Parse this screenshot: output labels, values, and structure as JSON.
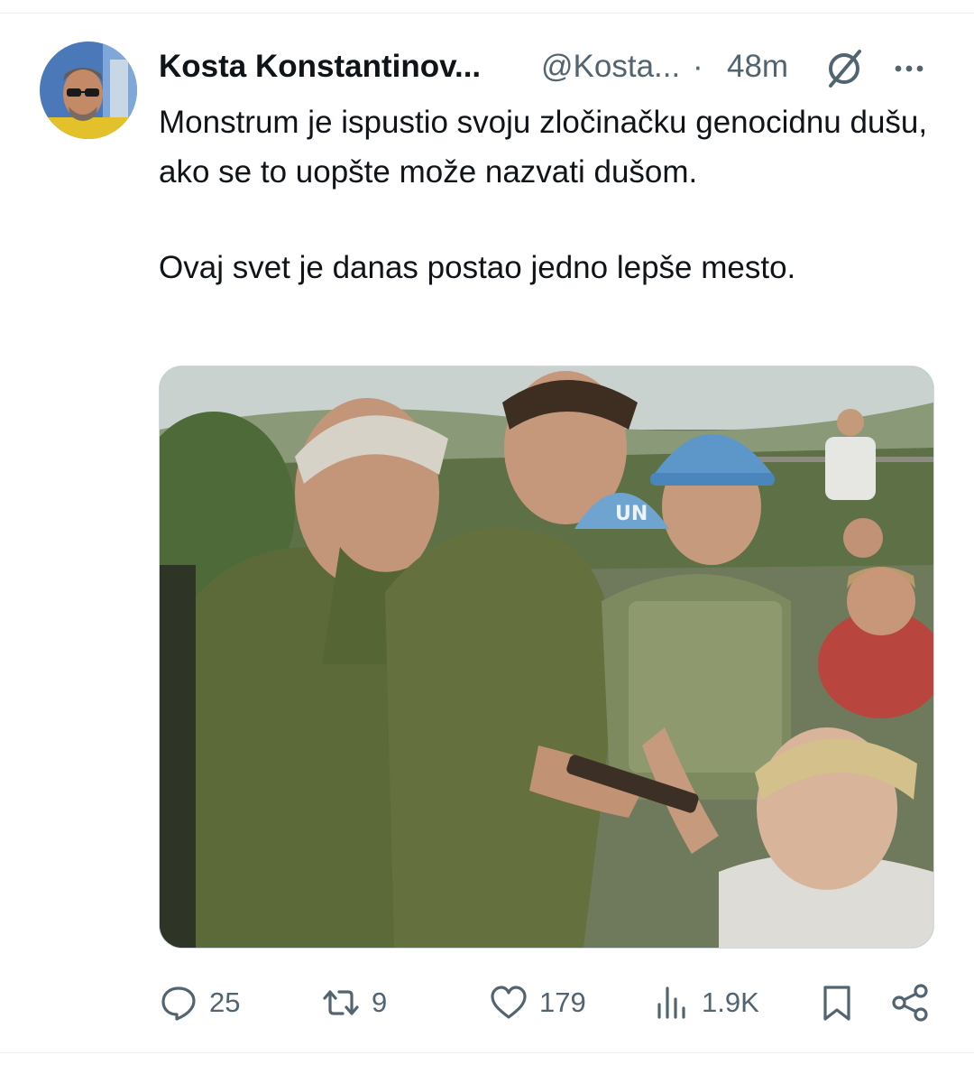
{
  "tweet": {
    "author": {
      "display_name": "Kosta Konstantinov...",
      "handle": "@Kosta...",
      "avatar_icon": "profile-photo"
    },
    "separator": "·",
    "time": "48m",
    "text_paragraphs": [
      "Monstrum je ispustio svoju zločinačku genocidnu dušu, ako se to uopšte može nazvati dušom.",
      "Ovaj svet je danas postao jedno lepše mesto."
    ],
    "media": {
      "type": "photo",
      "helmet_text": "UN"
    },
    "actions": {
      "replies": "25",
      "reposts": "9",
      "likes": "179",
      "views": "1.9K"
    }
  },
  "colors": {
    "text_primary": "#0f1419",
    "text_secondary": "#536471",
    "divider": "#eff3f4"
  },
  "icons": [
    "grok-icon",
    "more-icon",
    "reply-icon",
    "repost-icon",
    "like-icon",
    "views-icon",
    "bookmark-icon",
    "share-icon"
  ]
}
